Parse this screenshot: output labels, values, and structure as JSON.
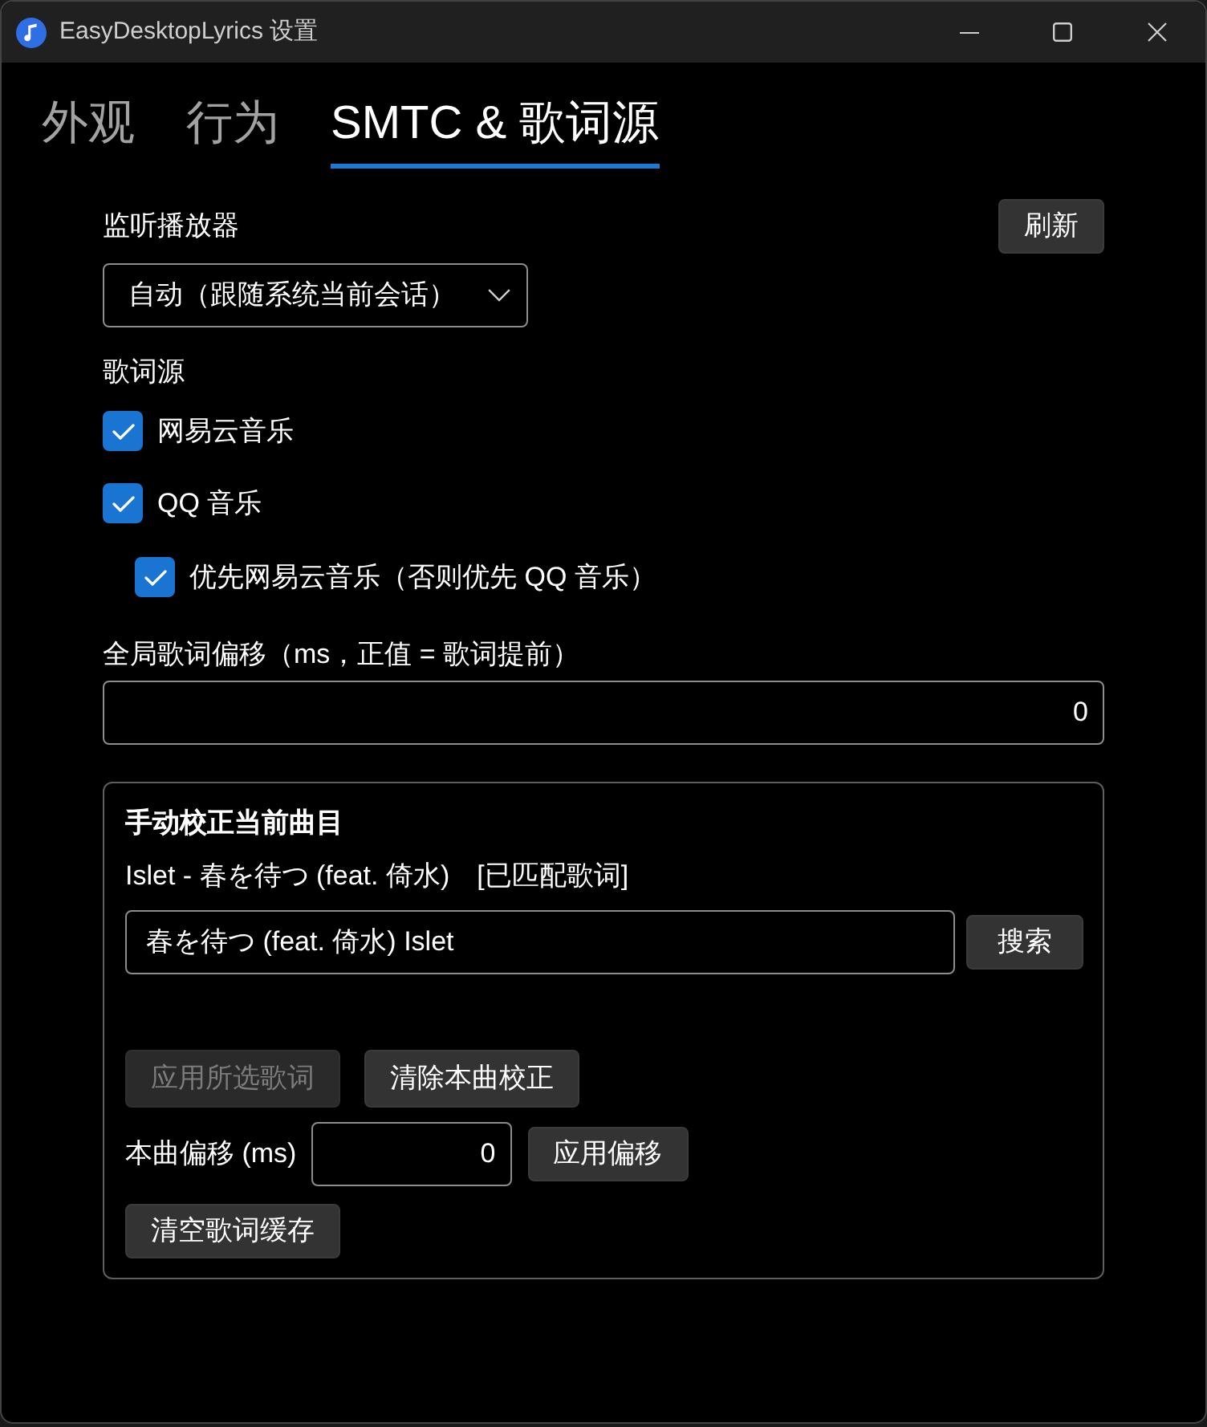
{
  "window": {
    "title": "EasyDesktopLyrics 设置"
  },
  "tabs": [
    {
      "label": "外观",
      "selected": false
    },
    {
      "label": "行为",
      "selected": false
    },
    {
      "label": "SMTC & 歌词源",
      "selected": true
    }
  ],
  "player": {
    "label": "监听播放器",
    "refresh_button": "刷新",
    "dropdown": {
      "value": "自动（跟随系统当前会话）"
    }
  },
  "lyric_sources": {
    "label": "歌词源",
    "options": [
      {
        "label": "网易云音乐",
        "checked": true
      },
      {
        "label": "QQ 音乐",
        "checked": true,
        "children": [
          {
            "label": "优先网易云音乐（否则优先 QQ 音乐）",
            "checked": true
          }
        ]
      }
    ]
  },
  "global_offset": {
    "label": "全局歌词偏移（ms，正值 = 歌词提前）",
    "value": "0"
  },
  "manual_correction": {
    "title": "手动校正当前曲目",
    "track": "Islet - 春を待つ (feat. 倚水)",
    "match_status": "[已匹配歌词]",
    "search": {
      "value": "春を待つ (feat. 倚水) Islet",
      "button": "搜索"
    },
    "actions": [
      {
        "label": "应用所选歌词",
        "disabled": true
      },
      {
        "label": "清除本曲校正",
        "disabled": false
      }
    ],
    "song_offset": {
      "label": "本曲偏移 (ms)",
      "value": "0",
      "button": "应用偏移"
    },
    "clear_cache_button": "清空歌词缓存"
  }
}
